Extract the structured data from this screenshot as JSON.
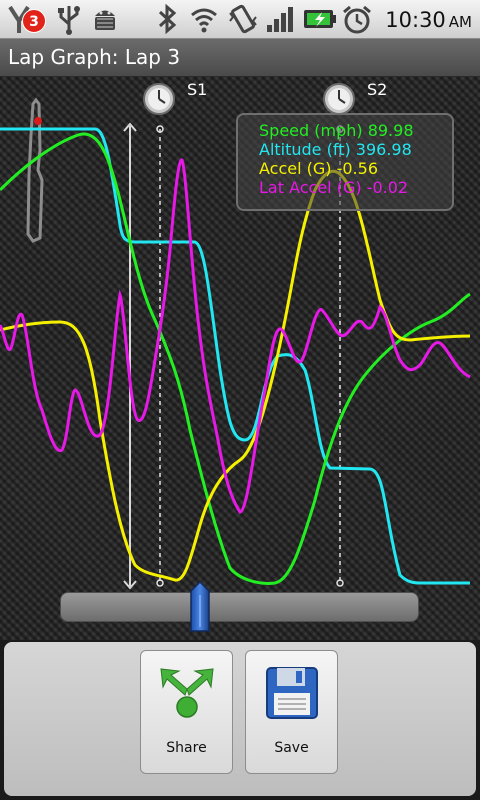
{
  "status_bar": {
    "notification_count": "3",
    "time": "10:30",
    "ampm": "AM",
    "icons": [
      "notification-icon",
      "usb-icon",
      "android-debug-icon",
      "bluetooth-icon",
      "wifi-icon",
      "vibrate-icon",
      "signal-icon",
      "battery-charging-icon",
      "alarm-icon"
    ]
  },
  "title_bar": {
    "title": "Lap Graph: Lap 3"
  },
  "graph": {
    "splits": [
      {
        "label": "S1"
      },
      {
        "label": "S2"
      }
    ],
    "colors": {
      "speed": "#22ee22",
      "altitude": "#22e6f0",
      "accel": "#f5f000",
      "lat_accel": "#e619e6"
    }
  },
  "legend": {
    "speed": "Speed (mph) 89.98",
    "altitude": "Altitude (ft) 396.98",
    "accel": "Accel (G) -0.56",
    "lat_accel": "Lat Accel (G) -0.02"
  },
  "slider": {
    "position": 0.39
  },
  "actions": {
    "share": "Share",
    "save": "Save"
  }
}
